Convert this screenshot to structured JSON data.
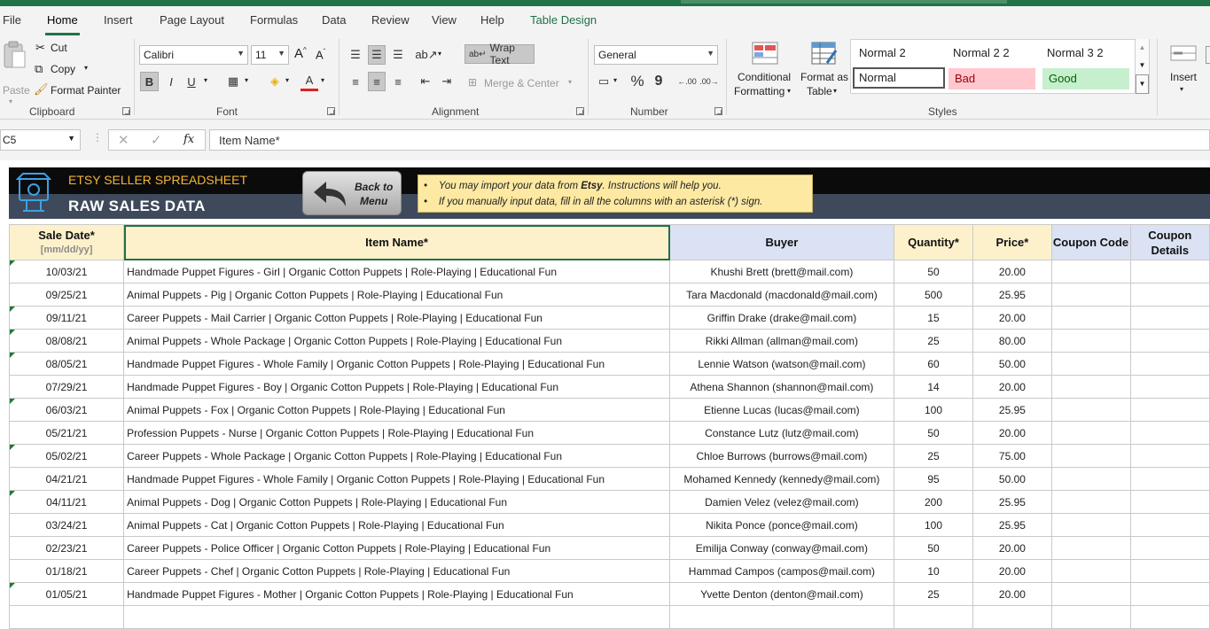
{
  "menu": {
    "tabs": [
      "File",
      "Home",
      "Insert",
      "Page Layout",
      "Formulas",
      "Data",
      "Review",
      "View",
      "Help",
      "Table Design"
    ],
    "active": "Home"
  },
  "ribbon": {
    "clipboard": {
      "paste": "Paste",
      "cut": "Cut",
      "copy": "Copy",
      "format_painter": "Format Painter",
      "label": "Clipboard"
    },
    "font": {
      "name": "Calibri",
      "size": "11",
      "bold": "B",
      "italic": "I",
      "underline": "U",
      "label": "Font",
      "grow": "A",
      "shrink": "A",
      "color_letter": "A"
    },
    "alignment": {
      "wrap_text": "Wrap Text",
      "merge_center": "Merge & Center",
      "label": "Alignment"
    },
    "number": {
      "format": "General",
      "label": "Number",
      "percent": "%",
      "comma": "9",
      "inc_decimal": ".00",
      "dec_decimal": ".00"
    },
    "styles": {
      "conditional": [
        "Conditional",
        "Formatting"
      ],
      "format_table": [
        "Format as",
        "Table"
      ],
      "cells": [
        "Normal 2",
        "Normal 2 2",
        "Normal 3 2",
        "Normal",
        "Bad",
        "Good"
      ],
      "label": "Styles"
    },
    "cells_group": {
      "insert": "Insert"
    },
    "colors": {
      "bad_bg": "#ffc7ce",
      "bad_fg": "#9c0006",
      "good_bg": "#c6efce",
      "good_fg": "#006100",
      "accent": "#217346"
    }
  },
  "formula_bar": {
    "name_box": "C5",
    "formula": "Item Name*",
    "fx": "fx"
  },
  "sheet": {
    "banner": {
      "subtitle": "ETSY SELLER SPREADSHEET",
      "title": "RAW SALES DATA",
      "back_button": [
        "Back to",
        "Menu"
      ],
      "notes": [
        {
          "pre": "You may import your data from ",
          "bold": "Etsy",
          "post": ". Instructions will help you."
        },
        {
          "pre": "If you manually input data,  fill in all the columns with an asterisk (*) sign.",
          "bold": "",
          "post": ""
        }
      ],
      "bullet": "•"
    },
    "headers": [
      {
        "label": "Sale Date*",
        "sub": "[mm/dd/yy]"
      },
      {
        "label": "Item Name*",
        "sub": ""
      },
      {
        "label": "Buyer",
        "sub": ""
      },
      {
        "label": "Quantity*",
        "sub": ""
      },
      {
        "label": "Price*",
        "sub": ""
      },
      {
        "label": "Coupon Code",
        "sub": ""
      },
      {
        "label": "Coupon",
        "sub": "Details"
      }
    ],
    "rows": [
      [
        "10/03/21",
        "Handmade Puppet Figures - Girl | Organic Cotton Puppets | Role-Playing | Educational Fun",
        "Khushi Brett (brett@mail.com)",
        "50",
        "20.00"
      ],
      [
        "09/25/21",
        "Animal Puppets - Pig | Organic Cotton Puppets | Role-Playing | Educational Fun",
        "Tara Macdonald (macdonald@mail.com)",
        "500",
        "25.95"
      ],
      [
        "09/11/21",
        "Career Puppets - Mail Carrier | Organic Cotton Puppets | Role-Playing | Educational Fun",
        "Griffin Drake (drake@mail.com)",
        "15",
        "20.00"
      ],
      [
        "08/08/21",
        "Animal Puppets - Whole Package | Organic Cotton Puppets | Role-Playing | Educational Fun",
        "Rikki Allman (allman@mail.com)",
        "25",
        "80.00"
      ],
      [
        "08/05/21",
        "Handmade Puppet Figures - Whole Family | Organic Cotton Puppets | Role-Playing | Educational Fun",
        "Lennie Watson (watson@mail.com)",
        "60",
        "50.00"
      ],
      [
        "07/29/21",
        "Handmade Puppet Figures - Boy | Organic Cotton Puppets | Role-Playing | Educational Fun",
        "Athena Shannon (shannon@mail.com)",
        "14",
        "20.00"
      ],
      [
        "06/03/21",
        "Animal Puppets - Fox | Organic Cotton Puppets | Role-Playing | Educational Fun",
        "Etienne Lucas (lucas@mail.com)",
        "100",
        "25.95"
      ],
      [
        "05/21/21",
        "Profession Puppets - Nurse | Organic Cotton Puppets | Role-Playing | Educational Fun",
        "Constance Lutz (lutz@mail.com)",
        "50",
        "20.00"
      ],
      [
        "05/02/21",
        "Career Puppets - Whole Package | Organic Cotton Puppets | Role-Playing | Educational Fun",
        "Chloe Burrows (burrows@mail.com)",
        "25",
        "75.00"
      ],
      [
        "04/21/21",
        "Handmade Puppet Figures - Whole Family | Organic Cotton Puppets | Role-Playing | Educational Fun",
        "Mohamed Kennedy (kennedy@mail.com)",
        "95",
        "50.00"
      ],
      [
        "04/11/21",
        "Animal Puppets - Dog | Organic Cotton Puppets | Role-Playing | Educational Fun",
        "Damien Velez (velez@mail.com)",
        "200",
        "25.95"
      ],
      [
        "03/24/21",
        "Animal Puppets - Cat | Organic Cotton Puppets | Role-Playing | Educational Fun",
        "Nikita Ponce (ponce@mail.com)",
        "100",
        "25.95"
      ],
      [
        "02/23/21",
        "Career Puppets - Police Officer | Organic Cotton Puppets | Role-Playing | Educational Fun",
        "Emilija Conway (conway@mail.com)",
        "50",
        "20.00"
      ],
      [
        "01/18/21",
        "Career Puppets - Chef | Organic Cotton Puppets | Role-Playing | Educational Fun",
        "Hammad Campos (campos@mail.com)",
        "10",
        "20.00"
      ],
      [
        "01/05/21",
        "Handmade Puppet Figures - Mother | Organic Cotton Puppets | Role-Playing | Educational Fun",
        "Yvette Denton (denton@mail.com)",
        "25",
        "20.00"
      ]
    ]
  }
}
